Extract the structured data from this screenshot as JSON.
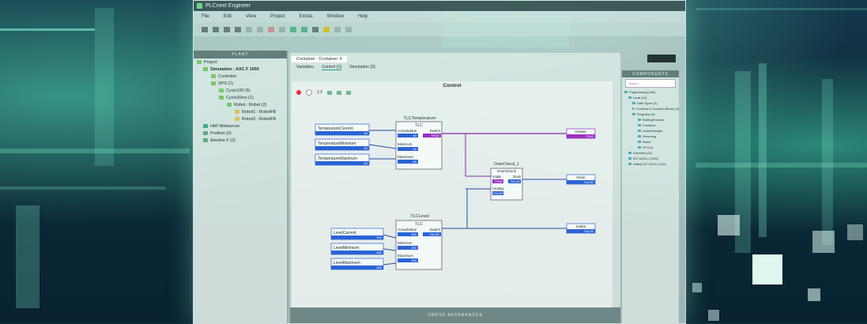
{
  "window": {
    "app_title": "PLCnext Engineer",
    "menus": [
      "File",
      "Edit",
      "View",
      "Project",
      "Extras",
      "Window",
      "Help"
    ]
  },
  "plant": {
    "header": "PLANT",
    "tree": [
      {
        "label": "Project",
        "level": 0
      },
      {
        "label": "Simulation : AXC F 1050",
        "level": 1
      },
      {
        "label": "Controller",
        "level": 2
      },
      {
        "label": "SPS (2)",
        "level": 2
      },
      {
        "label": "Cycle100 (5)",
        "level": 3
      },
      {
        "label": "Cycle30ms (1)",
        "level": 3
      },
      {
        "label": "Robot : Robot (2)",
        "level": 4
      },
      {
        "label": "Robot1 : RobotFB",
        "level": 5
      },
      {
        "label": "Robot2 : RobotFB",
        "level": 5
      },
      {
        "label": "HMI Webserver",
        "level": 1
      },
      {
        "label": "Profinet (0)",
        "level": 1
      },
      {
        "label": "Axioline F (0)",
        "level": 1
      }
    ]
  },
  "editor": {
    "tab": "Container : Container",
    "subtabs": [
      "Variables",
      "Control",
      "Simulation"
    ],
    "subtab_counts": [
      "",
      "[1]",
      "[2]"
    ],
    "canvas_title": "Control",
    "zoom_label": "1:2",
    "cross_reference": "CROSS REFERENCES",
    "filter_placeholder": "Search"
  },
  "diagram": {
    "tlc_temp": {
      "instance": "TLCTemperature",
      "type": "TLC",
      "in_actual": "ActualValue",
      "in_min": "Minimum",
      "in_max": "Maximum",
      "out": "Switch",
      "switch_value": "TRUE"
    },
    "tlc_level": {
      "instance": "TLCLevel",
      "type": "TLC",
      "in_actual": "ActualValue",
      "in_min": "Minimum",
      "in_max": "Maximum",
      "out": "Switch",
      "switch_value": "FALSE"
    },
    "drain": {
      "instance": "DrainCheck_1",
      "type": "DrainCheck",
      "in_intake": "Intake",
      "in_heating": "Heating",
      "out": "Drain",
      "intake_value": "TRUE",
      "heating_value": "FALSE",
      "drain_value": "FALSE"
    },
    "vars_temp": [
      {
        "name": "TemperatureCurrent",
        "value": "60"
      },
      {
        "name": "TemperatureMinimum",
        "value": "60"
      },
      {
        "name": "TemperatureMaximum",
        "value": "60"
      }
    ],
    "vars_level": [
      {
        "name": "LevelCurrent",
        "value": "900"
      },
      {
        "name": "LevelMinimum",
        "value": "900"
      },
      {
        "name": "LevelMaximum",
        "value": "900"
      }
    ],
    "tlc_temp_pin_values": {
      "actual": "60",
      "min": "60",
      "max": "60"
    },
    "tlc_level_pin_values": {
      "actual": "900",
      "min": "200",
      "max": "900"
    },
    "outputs": [
      {
        "name": "Heater",
        "value": "TRUE"
      },
      {
        "name": "Drain",
        "value": "FALSE"
      },
      {
        "name": "Intake",
        "value": "FALSE"
      }
    ]
  },
  "components": {
    "header": "COMPONENTS",
    "search_placeholder": "Search",
    "tree": [
      "Programming (24b)",
      "Local (10)",
      "Data Types (2)",
      "Functions & Function Blocks (3)",
      "Programs (6)",
      "BottlingProcess",
      "Container",
      "LadderSample",
      "Receiving",
      "Robot",
      "SFCLib",
      "Extended (11)",
      "IEC 61131-3 (109)",
      "Safety IEC 61131-3 (20)"
    ]
  }
}
